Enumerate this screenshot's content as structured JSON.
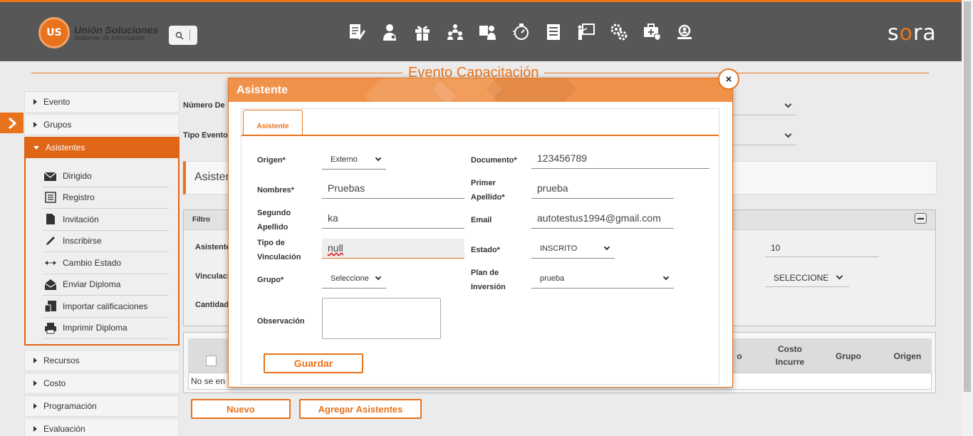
{
  "header": {
    "logo_mark": "US",
    "logo_title": "Unión Soluciones",
    "logo_subtitle": "Sistemas de Información",
    "brand_left": "s",
    "brand_o": "o",
    "brand_right": "ra",
    "nav_icons": [
      "document-edit-icon",
      "person-icon",
      "gift-icon",
      "group-icon",
      "person-board-icon",
      "timer-icon",
      "list-document-icon",
      "presentation-icon",
      "gears-icon",
      "medical-case-icon",
      "search-people-icon"
    ]
  },
  "page": {
    "title": "Evento Capacitación"
  },
  "menu": {
    "items_top": [
      {
        "label": "Evento"
      },
      {
        "label": "Grupos"
      }
    ],
    "active": {
      "label": "Asistentes"
    },
    "submenu": [
      {
        "label": "Dirigido",
        "icon": "envelope-icon"
      },
      {
        "label": "Registro",
        "icon": "form-icon"
      },
      {
        "label": "Invitación",
        "icon": "document-icon"
      },
      {
        "label": "Inscribirse",
        "icon": "pen-icon"
      },
      {
        "label": "Cambio Estado",
        "icon": "arrows-icon"
      },
      {
        "label": "Enviar Diploma",
        "icon": "send-envelope-icon"
      },
      {
        "label": "Importar calificaciones",
        "icon": "import-icon"
      },
      {
        "label": "Imprimir Diploma",
        "icon": "printer-icon"
      }
    ],
    "items_bottom": [
      {
        "label": "Recursos"
      },
      {
        "label": "Costo"
      },
      {
        "label": "Programación"
      },
      {
        "label": "Evaluación"
      }
    ]
  },
  "background": {
    "numero_label": "Número De",
    "tipo_label": "Tipo Evento",
    "asist_panel_title": "Asister",
    "filtro_title": "Filtro",
    "f_asistente": "Asistente",
    "f_vinculacion": "Vinculaci",
    "f_cantidad": "Cantidad",
    "f_right_value": "10",
    "f_right_select": "SELECCIONE",
    "grid_cols": [
      "o",
      "Costo Incurre",
      "Grupo",
      "Origen"
    ],
    "grid_empty": "No se en",
    "btn_nuevo": "Nuevo",
    "btn_agregar": "Agregar Asistentes"
  },
  "modal": {
    "title": "Asistente",
    "close": "×",
    "tab": "Asistente",
    "labels": {
      "origen": "Origen*",
      "documento": "Documento*",
      "nombres": "Nombres*",
      "primer_apellido": "Primer Apellido*",
      "segundo_apellido": "Segundo Apellido",
      "email": "Email",
      "tipo_vinculacion": "Tipo de Vinculación",
      "estado": "Estado*",
      "grupo": "Grupo*",
      "plan_inversion": "Plan de Inversión",
      "observacion": "Observación"
    },
    "values": {
      "origen": "Externo",
      "documento": "123456789",
      "nombres": "Pruebas",
      "primer_apellido": "prueba",
      "segundo_apellido": "ka",
      "email": "autotestus1994@gmail.com",
      "tipo_vinculacion": "null",
      "estado": "INSCRITO",
      "grupo": "Seleccione",
      "plan_inversion": "prueba",
      "observacion": ""
    },
    "save_label": "Guardar"
  },
  "colors": {
    "accent": "#e8731c",
    "header_bg": "#575757"
  }
}
